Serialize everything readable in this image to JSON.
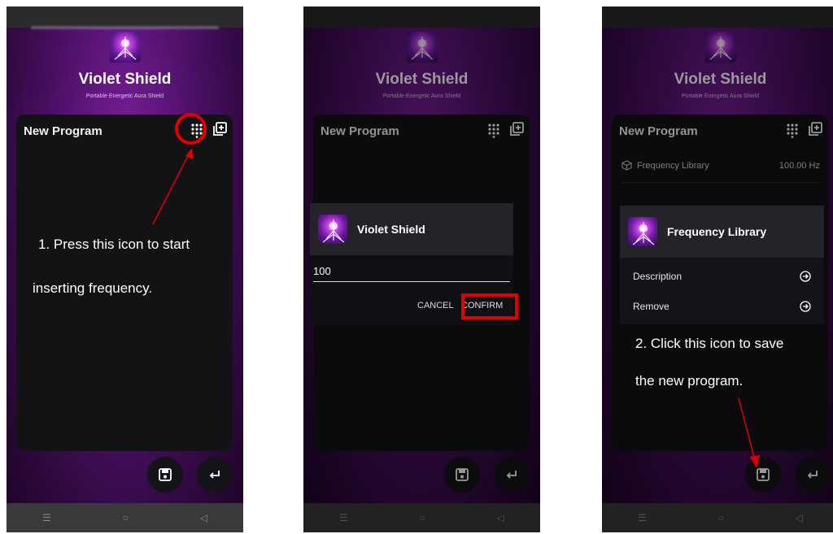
{
  "app": {
    "title": "Violet Shield",
    "subtitle": "Portable Energetic Aura Shield",
    "card_title": "New Program"
  },
  "panel1": {
    "instruction_line1": "1. Press this icon to start",
    "instruction_line2": "inserting frequency."
  },
  "panel2": {
    "dialog_title": "Violet Shield",
    "input_value": "100",
    "cancel_label": "CANCEL",
    "confirm_label": "CONFIRM"
  },
  "panel3": {
    "library_label": "Frequency Library",
    "library_value": "100.00 Hz",
    "menu_title": "Frequency Library",
    "menu_items": [
      "Description",
      "Remove"
    ],
    "instruction_line1": "2. Click this icon to save",
    "instruction_line2": "the new program."
  },
  "nav": {
    "menu": "☰",
    "home": "○",
    "back": "◁"
  },
  "colors": {
    "accent_red": "#e00000",
    "card_bg": "#131316",
    "purple": "#6a1a8a"
  },
  "icons": [
    "keypad-icon",
    "add-copy-icon",
    "save-icon",
    "return-icon",
    "cube-icon",
    "arrow-circle-right-icon"
  ]
}
